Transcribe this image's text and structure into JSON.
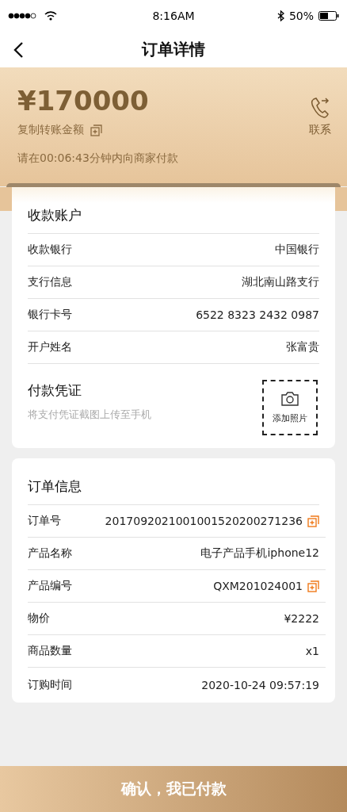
{
  "status_bar": {
    "time": "8:16AM",
    "battery": "50%"
  },
  "nav": {
    "title": "订单详情"
  },
  "header": {
    "amount": "¥170000",
    "copy_label": "复制转账金额",
    "contact_label": "联系",
    "countdown": "请在00:06:43分钟内向商家付款"
  },
  "account": {
    "title": "收款账户",
    "rows": [
      {
        "label": "收款银行",
        "value": "中国银行"
      },
      {
        "label": "支行信息",
        "value": "湖北南山路支行"
      },
      {
        "label": "银行卡号",
        "value": "6522 8323 2432 0987"
      },
      {
        "label": "开户姓名",
        "value": "张富贵"
      }
    ]
  },
  "voucher": {
    "title": "付款凭证",
    "hint": "将支付凭证截图上传至手机",
    "upload_label": "添加照片"
  },
  "order": {
    "title": "订单信息",
    "rows": [
      {
        "label": "订单号",
        "value": "2017092021001001520200271236",
        "copyable": true
      },
      {
        "label": "产品名称",
        "value": "电子产品手机iphone12",
        "copyable": false
      },
      {
        "label": "产品编号",
        "value": "QXM201024001",
        "copyable": true
      },
      {
        "label": "物价",
        "value": "¥2222",
        "copyable": false
      },
      {
        "label": "商品数量",
        "value": "x1",
        "copyable": false
      },
      {
        "label": "订购时间",
        "value": "2020-10-24 09:57:19",
        "copyable": false
      }
    ]
  },
  "confirm_button": "确认，我已付款"
}
